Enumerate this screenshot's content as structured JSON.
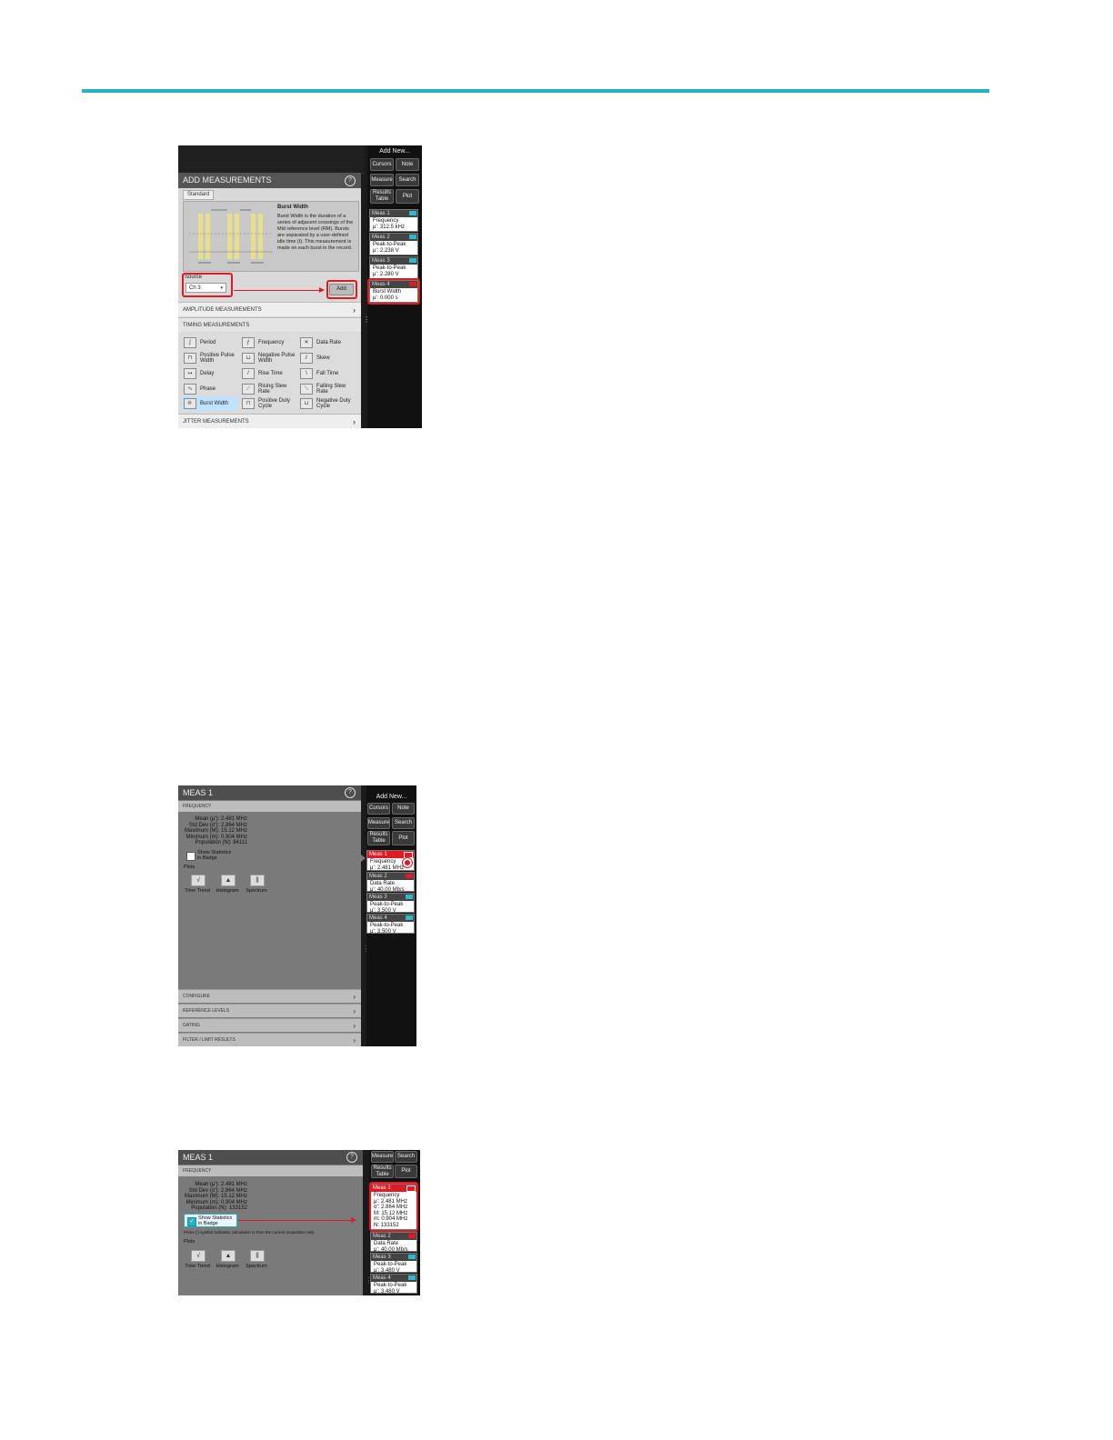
{
  "shot1": {
    "panel_title": "ADD MEASUREMENTS",
    "tab_label": "Standard",
    "desc_title": "Burst Width",
    "desc_text": "Burst Width is the duration of a series of adjacent crossings of the Mid reference level (RM). Bursts are separated by a user-defined idle time (t). This measurement is made on each burst in the record.",
    "source_label": "Source",
    "source_value": "Ch 3",
    "add_button": "Add",
    "sections": {
      "amplitude": "AMPLITUDE MEASUREMENTS",
      "timing": "TIMING MEASUREMENTS",
      "jitter": "JITTER MEASUREMENTS"
    },
    "measurements": [
      {
        "label": "Period",
        "icon": "period-icon"
      },
      {
        "label": "Frequency",
        "icon": "frequency-icon"
      },
      {
        "label": "Data Rate",
        "icon": "data-rate-icon"
      },
      {
        "label": "Positive Pulse Width",
        "icon": "positive-pulse-icon"
      },
      {
        "label": "Negative Pulse Width",
        "icon": "negative-pulse-icon"
      },
      {
        "label": "Skew",
        "icon": "skew-icon"
      },
      {
        "label": "Delay",
        "icon": "delay-icon"
      },
      {
        "label": "Rise Time",
        "icon": "rise-time-icon"
      },
      {
        "label": "Fall Time",
        "icon": "fall-time-icon"
      },
      {
        "label": "Phase",
        "icon": "phase-icon"
      },
      {
        "label": "Rising Slew Rate",
        "icon": "rising-slew-icon"
      },
      {
        "label": "Falling Slew Rate",
        "icon": "falling-slew-icon"
      },
      {
        "label": "Burst Width",
        "icon": "burst-width-icon"
      },
      {
        "label": "Positive Duty Cycle",
        "icon": "positive-duty-icon"
      },
      {
        "label": "Negative Duty Cycle",
        "icon": "negative-duty-icon"
      }
    ],
    "right_panel": {
      "add_new": "Add New...",
      "cursors": "Cursors",
      "note": "Note",
      "measure": "Measure",
      "search": "Search",
      "results_table": "Results Table",
      "plot": "Plot"
    },
    "badges": [
      {
        "title": "Meas 1",
        "name": "Frequency",
        "value": "μ': 312.5 kHz"
      },
      {
        "title": "Meas 2",
        "name": "Peak-to-Peak",
        "value": "μ': 2.238 V"
      },
      {
        "title": "Meas 3",
        "name": "Peak-to-Peak",
        "value": "μ': 2.280 V"
      },
      {
        "title": "Meas 4",
        "name": "Burst Width",
        "value": "μ': 0.000 s"
      }
    ]
  },
  "shot2": {
    "panel_title": "MEAS 1",
    "section": "FREQUENCY",
    "stats": [
      "Mean (μ'): 2.481 MHz",
      "Std Dev (σ'): 2.864 MHz",
      "Maximum (M): 15.12 MHz",
      "Minimum (m): 0.904 MHz",
      "Population (N): 84111"
    ],
    "show_stats_label": "Show Statistics in Badge",
    "plots_label": "Plots",
    "plots": [
      "Time Trend",
      "Histogram",
      "Spectrum"
    ],
    "bottom_sections": [
      "CONFIGURE",
      "REFERENCE LEVELS",
      "GATING",
      "FILTER / LIMIT RESULTS"
    ],
    "right_panel": {
      "add_new": "Add New...",
      "cursors": "Cursors",
      "note": "Note",
      "measure": "Measure",
      "search": "Search",
      "results_table": "Results Table",
      "plot": "Plot"
    },
    "badges": [
      {
        "title": "Meas 1",
        "name": "Frequency",
        "value": "μ': 2.481 MHz"
      },
      {
        "title": "Meas 2",
        "name": "Data Rate",
        "value": "μ': 40.00 Mb/s"
      },
      {
        "title": "Meas 3",
        "name": "Peak-to-Peak",
        "value": "μ': 3.500 V"
      },
      {
        "title": "Meas 4",
        "name": "Peak-to-Peak",
        "value": "μ': 3.500 V"
      }
    ]
  },
  "shot3": {
    "panel_title": "MEAS 1",
    "section": "FREQUENCY",
    "stats": [
      "Mean (μ'): 2.481 MHz",
      "Std Dev (σ'): 2.864 MHz",
      "Maximum (M): 15.12 MHz",
      "Minimum (m): 0.904 MHz",
      "Population (N): 133152"
    ],
    "show_stats_label": "Show Statistics in Badge",
    "prime_note": "Prime (') symbol indicates calculation is from the current acquisition only.",
    "plots_label": "Plots",
    "plots": [
      "Time Trend",
      "Histogram",
      "Spectrum"
    ],
    "right_panel": {
      "measure": "Measure",
      "search": "Search",
      "results_table": "Results Table",
      "plot": "Plot"
    },
    "badge1": {
      "title": "Meas 1",
      "lines": [
        "Frequency",
        "μ': 2.481 MHz",
        "σ': 2.864 MHz",
        "M: 15.12 MHz",
        "m: 0.904 MHz",
        "N: 133152"
      ]
    },
    "badges": [
      {
        "title": "Meas 2",
        "name": "Data Rate",
        "value": "μ': 40.00 Mb/s"
      },
      {
        "title": "Meas 3",
        "name": "Peak-to-Peak",
        "value": "μ': 3.480 V"
      },
      {
        "title": "Meas 4",
        "name": "Peak-to-Peak",
        "value": "μ': 3.480 V"
      }
    ]
  },
  "colors": {
    "rule": "#27b1c4",
    "highlight": "#e01a22",
    "badge_tag": "#2db9c9"
  }
}
